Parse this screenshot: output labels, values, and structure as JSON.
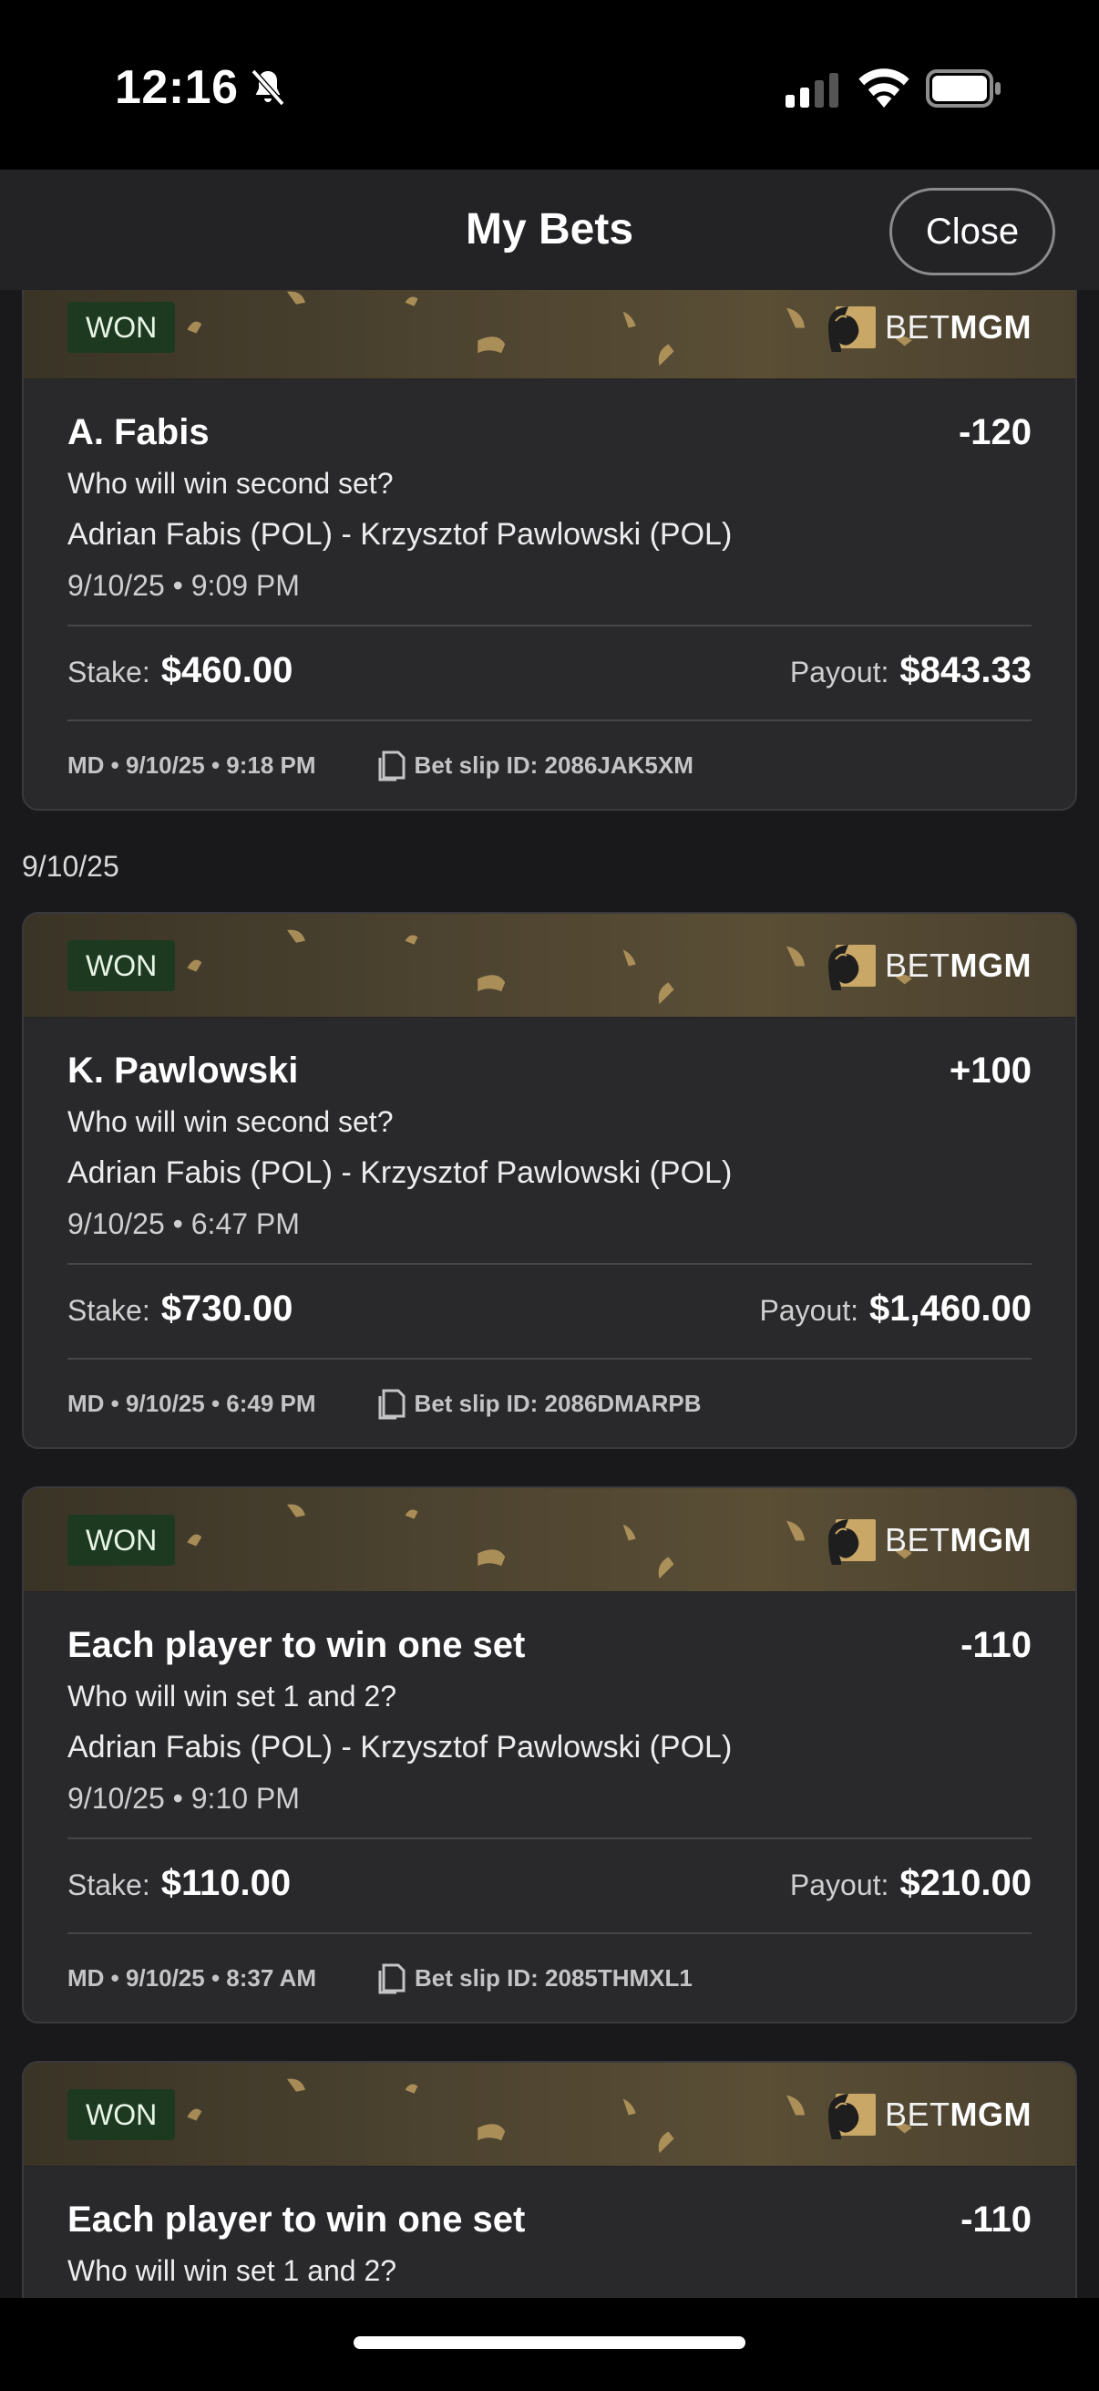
{
  "status_bar": {
    "time": "12:16"
  },
  "header": {
    "title": "My Bets",
    "close_label": "Close"
  },
  "brand": {
    "bet": "BET",
    "mgm": "MGM"
  },
  "date_separator": "9/10/25",
  "bets": [
    {
      "status": "WON",
      "selection": "A. Fabis",
      "odds": "-120",
      "market": "Who will win second set?",
      "event": "Adrian Fabis (POL) - Krzysztof Pawlowski (POL)",
      "event_time": "9/10/25 • 9:09 PM",
      "stake_label": "Stake:",
      "stake": "$460.00",
      "payout_label": "Payout:",
      "payout": "$843.33",
      "meta": "MD • 9/10/25 • 9:18 PM",
      "slip_id": "Bet slip ID: 2086JAK5XM"
    },
    {
      "status": "WON",
      "selection": "K. Pawlowski",
      "odds": "+100",
      "market": "Who will win second set?",
      "event": "Adrian Fabis (POL) - Krzysztof Pawlowski (POL)",
      "event_time": "9/10/25 • 6:47 PM",
      "stake_label": "Stake:",
      "stake": "$730.00",
      "payout_label": "Payout:",
      "payout": "$1,460.00",
      "meta": "MD • 9/10/25 • 6:49 PM",
      "slip_id": "Bet slip ID: 2086DMARPB"
    },
    {
      "status": "WON",
      "selection": "Each player to win one set",
      "odds": "-110",
      "market": "Who will win set 1 and 2?",
      "event": "Adrian Fabis (POL) - Krzysztof Pawlowski (POL)",
      "event_time": "9/10/25 • 9:10 PM",
      "stake_label": "Stake:",
      "stake": "$110.00",
      "payout_label": "Payout:",
      "payout": "$210.00",
      "meta": "MD • 9/10/25 • 8:37 AM",
      "slip_id": "Bet slip ID: 2085THMXL1"
    },
    {
      "status": "WON",
      "selection": "Each player to win one set",
      "odds": "-110",
      "market": "Who will win set 1 and 2?"
    }
  ],
  "colors": {
    "won_badge_bg": "#1d3a20",
    "card_bg": "#29292c",
    "gold": "#c9a766"
  }
}
